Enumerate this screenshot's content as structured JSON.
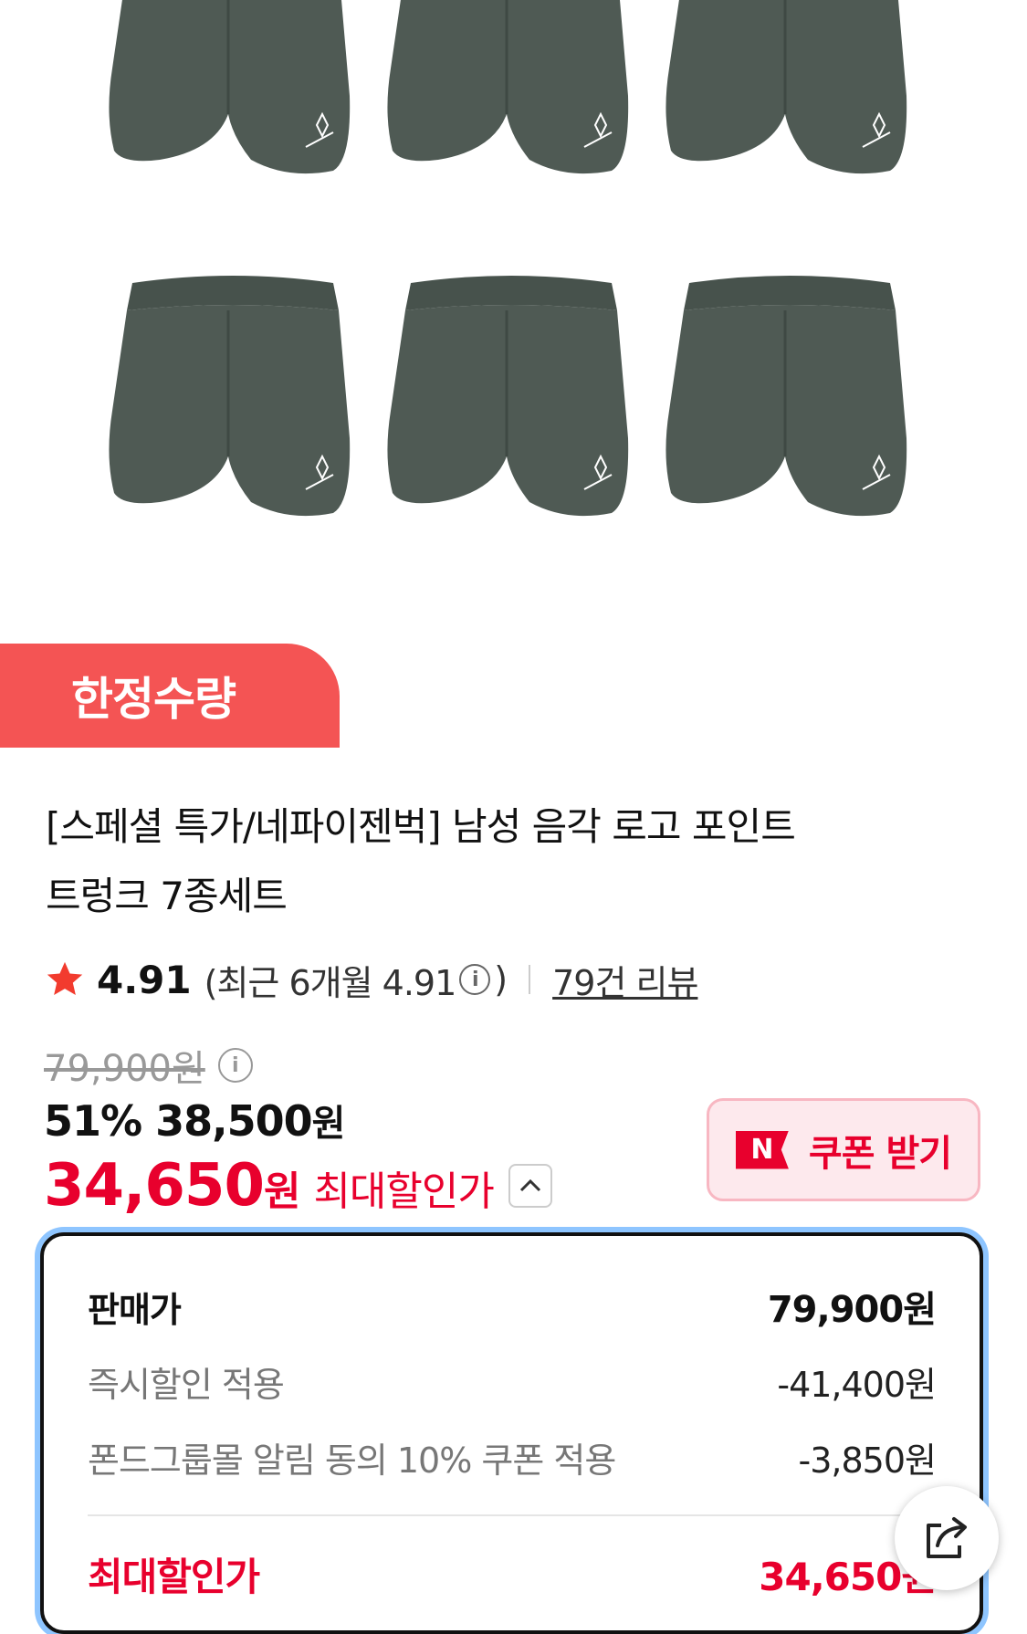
{
  "product": {
    "badge": "한정수량",
    "title_line1": "[스페셜 특가/네파이젠벅] 남성 음각 로고 포인트",
    "title_line2": "트렁크 7종세트"
  },
  "rating": {
    "score": "4.91",
    "recent_prefix": "(최근 6개월 4.91",
    "recent_suffix": ")",
    "review_link": "79건 리뷰"
  },
  "price": {
    "original": "79,900원",
    "sale_text": "51% 38,500",
    "sale_won": "원",
    "max_price": "34,650",
    "max_won": "원",
    "max_label": "최대할인가",
    "coupon_button": "쿠폰 받기",
    "coupon_logo": "N"
  },
  "breakdown": {
    "rows": [
      {
        "label": "판매가",
        "value": "79,900원"
      },
      {
        "label": "즉시할인 적용",
        "value": "-41,400원"
      },
      {
        "label": "폰드그룹몰 알림 동의 10% 쿠폰 적용",
        "value": "-3,850원"
      },
      {
        "label": "최대할인가",
        "value": "34,650원"
      }
    ]
  },
  "colors": {
    "badge": "#f45454",
    "accent_red": "#e8002d",
    "box_focus": "#8ec5ff",
    "star": "#f23b2e",
    "garment": "#4f5a54"
  },
  "icons": [
    "star-icon",
    "info-icon",
    "chevron-up-icon",
    "share-icon"
  ]
}
